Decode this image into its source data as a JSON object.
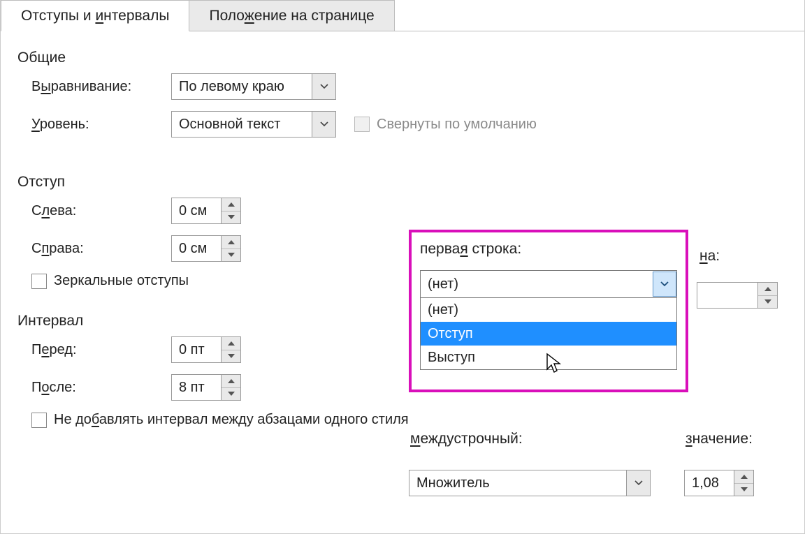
{
  "tabs": {
    "indents": "Отступы и интервалы",
    "indents_ul": "и",
    "position": "Положение на странице",
    "position_ul": "ж"
  },
  "general": {
    "title": "Общие",
    "alignment_label": "Выравнивание:",
    "alignment_ul": "ы",
    "alignment_value": "По левому краю",
    "outline_label": "Уровень:",
    "outline_ul": "У",
    "outline_value": "Основной текст",
    "collapsed_label": "Свернуты по умолчанию"
  },
  "indent": {
    "title": "Отступ",
    "left_label": "Слева:",
    "left_ul": "л",
    "left_value": "0 см",
    "right_label": "Справа:",
    "right_ul": "п",
    "right_value": "0 см",
    "mirror_label": "Зеркальные отступы",
    "firstline_label": "первая строка:",
    "firstline_ul": "я",
    "firstline_value": "(нет)",
    "firstline_options": {
      "none": "(нет)",
      "indent": "Отступ",
      "hanging": "Выступ"
    },
    "by_label": "на:",
    "by_ul": "н",
    "by_value": ""
  },
  "spacing": {
    "title": "Интервал",
    "before_label": "Перед:",
    "before_ul": "е",
    "before_value": "0 пт",
    "after_label": "После:",
    "after_ul": "о",
    "after_value": "8 пт",
    "linespacing_label": "междустрочный:",
    "linespacing_ul": "м",
    "linespacing_value": "Множитель",
    "value_label": "значение:",
    "value_ul": "з",
    "value_value": "1,08",
    "noaddspace_label": "Не добавлять интервал между абзацами одного стиля",
    "noaddspace_ul": "б"
  }
}
